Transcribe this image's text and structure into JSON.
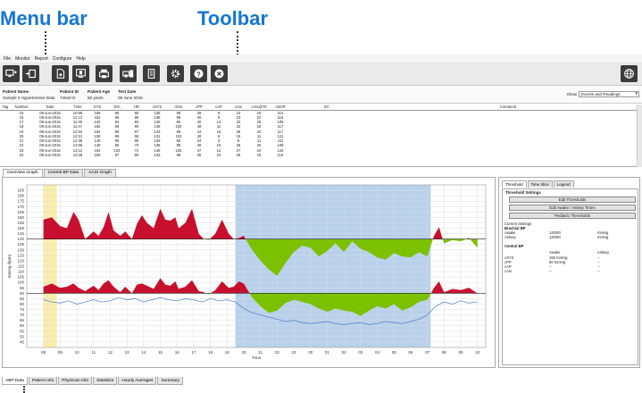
{
  "callouts": {
    "menu_bar": "Menu bar",
    "toolbar": "Toolbar"
  },
  "menu": [
    "File",
    "Monitor",
    "Report",
    "Configure",
    "Help"
  ],
  "toolbar_icons": [
    "monitor-arrow-icon",
    "device-arrow-icon",
    "document-plus-icon",
    "screen-document-icon",
    "printer-icon",
    "printer-stack-icon",
    "report-page-icon",
    "gear-icon",
    "help-icon",
    "close-icon"
  ],
  "globe_icon": "globe-icon",
  "patient": {
    "name_label": "Patient Name",
    "name": "Sample 2 Hypertensive Data",
    "id_label": "Patient ID",
    "id": "74642-D",
    "age_label": "Patient Age",
    "age": "65 years",
    "date_label": "Test Date",
    "date": "08 June 2015",
    "show_label": "Show",
    "show_value": "Events and Readings"
  },
  "table": {
    "headers": [
      "Tag",
      "Number",
      "Date",
      "Time",
      "SYS",
      "DIA",
      "HR",
      "cSYS",
      "cDIA",
      "cPP",
      "cAP",
      "cAIx",
      "cAIx@75",
      "cMAP",
      "EC",
      "Comment"
    ],
    "rows": [
      [
        "",
        "15",
        "09-Jun-2015",
        "10:56",
        "159",
        "99",
        "80",
        "138",
        "99",
        "39",
        "9",
        "23",
        "19",
        "114",
        "",
        ""
      ],
      [
        "",
        "16",
        "09-Jun-2015",
        "11:13",
        "152",
        "96",
        "88",
        "138",
        "98",
        "40",
        "9",
        "23",
        "22",
        "116",
        "",
        ""
      ],
      [
        "",
        "17",
        "09-Jun-2015",
        "11:30",
        "140",
        "84",
        "83",
        "129",
        "90",
        "40",
        "13",
        "32",
        "28",
        "105",
        "",
        ""
      ],
      [
        "",
        "18",
        "09-Jun-2015",
        "11:47",
        "162",
        "99",
        "80",
        "148",
        "100",
        "48",
        "11",
        "32",
        "15",
        "117",
        "",
        ""
      ],
      [
        "",
        "19",
        "09-Jun-2015",
        "12:04",
        "154",
        "98",
        "87",
        "143",
        "99",
        "44",
        "16",
        "36",
        "33",
        "117",
        "",
        ""
      ],
      [
        "",
        "20",
        "09-Jun-2015",
        "12:21",
        "108",
        "99",
        "66",
        "131",
        "102",
        "49",
        "8",
        "15",
        "11",
        "121",
        "",
        ""
      ],
      [
        "",
        "21",
        "09-Jun-2015",
        "12:38",
        "145",
        "95",
        "80",
        "129",
        "96",
        "34",
        "3",
        "8",
        "11",
        "111",
        "",
        ""
      ],
      [
        "",
        "22",
        "09-Jun-2015",
        "12:55",
        "148",
        "86",
        "70",
        "136",
        "88",
        "48",
        "19",
        "38",
        "35",
        "108",
        "",
        ""
      ],
      [
        "",
        "23",
        "09-Jun-2015",
        "13:12",
        "164",
        "102",
        "72",
        "149",
        "102",
        "47",
        "12",
        "27",
        "24",
        "122",
        "",
        ""
      ],
      [
        "",
        "24",
        "09-Jun-2015",
        "13:28",
        "150",
        "97",
        "80",
        "133",
        "98",
        "35",
        "10",
        "25",
        "18",
        "115",
        "",
        ""
      ]
    ]
  },
  "graph_tabs": [
    "Overview Graph",
    "Central BP Data",
    "AASI Graph"
  ],
  "right_tabs": [
    "Threshold",
    "Time Slice",
    "Legend"
  ],
  "threshold": {
    "title": "Threshold Settings",
    "buttons": [
      "Edit Thresholds",
      "Edit Awake / Asleep Times",
      "Pediatric Thresholds"
    ],
    "current": "Current Settings",
    "brachial": "Brachial BP",
    "awake_label": "Awake",
    "awake_val": "140/90",
    "awake_unit": "mmHg",
    "asleep_label": "Asleep",
    "asleep_val": "120/80",
    "asleep_unit": "mmHg",
    "central": "Central BP",
    "col_awake": "Awake",
    "col_asleep": "Asleep",
    "rows": [
      {
        "label": "cSYS",
        "awake": "150 mmHg",
        "asleep": "--"
      },
      {
        "label": "cPP",
        "awake": "50 mmHg",
        "asleep": "--"
      },
      {
        "label": "cAP",
        "awake": "--",
        "asleep": "--"
      },
      {
        "label": "cAIx",
        "awake": "--",
        "asleep": "--"
      }
    ]
  },
  "bottom_tabs": [
    "ABP Data",
    "Patient Info",
    "Physician Info",
    "Statistics",
    "Hourly Averages",
    "Summary"
  ],
  "chart_data": {
    "type": "area",
    "xlabel": "Time",
    "ylabel": "mmHg (bpm)",
    "ylim": [
      40,
      190
    ],
    "yticks": [
      45,
      50,
      55,
      60,
      65,
      70,
      75,
      80,
      85,
      90,
      95,
      100,
      105,
      110,
      115,
      120,
      125,
      130,
      135,
      140,
      145,
      150,
      155,
      160,
      165,
      170,
      175,
      180,
      185
    ],
    "x_tick_labels": [
      "08",
      "09",
      "10",
      "11",
      "12",
      "13",
      "14",
      "15",
      "16",
      "17",
      "18",
      "19",
      "20",
      "21",
      "22",
      "23",
      "00",
      "01",
      "02",
      "03",
      "04",
      "05",
      "06",
      "07",
      "08",
      "09",
      "10"
    ],
    "x_hours": [
      8,
      9,
      10,
      11,
      12,
      13,
      14,
      15,
      16,
      17,
      18,
      19,
      20,
      21,
      22,
      23,
      24,
      25,
      26,
      27,
      28,
      29,
      30,
      31,
      32,
      33,
      34
    ],
    "xlim": [
      7.0,
      34.5
    ],
    "highlight_band": {
      "x": [
        8.0,
        8.8
      ],
      "color": "#f9eeaa"
    },
    "sleep_band": {
      "x": [
        19.5,
        31.2
      ],
      "color": "#b8d0ec"
    },
    "grid": true,
    "legend": "none",
    "series": [
      {
        "key": "SYS",
        "threshold": 140,
        "above_color": "#c8102e",
        "below_color": "#7cc100",
        "x": [
          8.0,
          8.5,
          9.0,
          9.4,
          9.8,
          10.1,
          10.5,
          11.0,
          11.3,
          11.6,
          11.9,
          12.2,
          12.6,
          12.9,
          13.3,
          13.6,
          13.9,
          14.2,
          14.6,
          15.0,
          15.3,
          15.6,
          15.9,
          16.1,
          16.5,
          16.9,
          17.3,
          17.6,
          17.9,
          18.3,
          18.7,
          19.1,
          19.4,
          19.7,
          20.0,
          20.5,
          21.0,
          21.5,
          22.0,
          22.5,
          23.0,
          23.5,
          24.0,
          24.5,
          25.0,
          25.5,
          26.0,
          26.5,
          27.0,
          27.5,
          28.0,
          28.5,
          29.0,
          29.5,
          30.0,
          30.5,
          31.0,
          31.4,
          31.7,
          32.0,
          32.5,
          33.0,
          33.5,
          34.0
        ],
        "y": [
          158,
          160,
          152,
          150,
          165,
          158,
          140,
          147,
          143,
          151,
          165,
          148,
          143,
          147,
          140,
          154,
          162,
          155,
          150,
          168,
          158,
          157,
          160,
          150,
          155,
          168,
          145,
          140,
          139,
          145,
          158,
          145,
          140,
          141,
          143,
          130,
          120,
          112,
          106,
          118,
          128,
          134,
          132,
          124,
          129,
          136,
          128,
          138,
          131,
          128,
          123,
          121,
          127,
          124,
          123,
          128,
          124,
          143,
          151,
          136,
          139,
          138,
          141,
          132
        ]
      },
      {
        "key": "DIA",
        "threshold": 90,
        "above_color": "#c8102e",
        "below_color": "#7cc100",
        "x": [
          8.0,
          8.5,
          9.0,
          9.4,
          9.8,
          10.1,
          10.5,
          11.0,
          11.3,
          11.6,
          11.9,
          12.2,
          12.6,
          12.9,
          13.3,
          13.6,
          13.9,
          14.2,
          14.6,
          15.0,
          15.3,
          15.6,
          15.9,
          16.1,
          16.5,
          16.9,
          17.3,
          17.6,
          17.9,
          18.3,
          18.7,
          19.1,
          19.4,
          19.7,
          20.0,
          20.5,
          21.0,
          21.5,
          22.0,
          22.5,
          23.0,
          23.5,
          24.0,
          24.5,
          25.0,
          25.5,
          26.0,
          26.5,
          27.0,
          27.5,
          28.0,
          28.5,
          29.0,
          29.5,
          30.0,
          30.5,
          31.0,
          31.4,
          31.7,
          32.0,
          32.5,
          33.0,
          33.5,
          34.0
        ],
        "y": [
          96,
          99,
          95,
          96,
          99,
          95,
          92,
          97,
          93,
          99,
          102,
          96,
          91,
          96,
          90,
          98,
          99,
          97,
          94,
          104,
          98,
          97,
          101,
          94,
          96,
          102,
          92,
          91,
          89,
          93,
          101,
          95,
          96,
          101,
          99,
          86,
          78,
          72,
          74,
          81,
          84,
          82,
          80,
          76,
          73,
          76,
          74,
          73,
          69,
          74,
          78,
          76,
          80,
          74,
          77,
          82,
          84,
          95,
          101,
          91,
          94,
          93,
          95,
          90
        ]
      },
      {
        "key": "HR",
        "color": "#4a7cc8",
        "x": [
          8.0,
          8.5,
          9.0,
          9.5,
          10.0,
          10.5,
          11.0,
          11.5,
          12.0,
          12.5,
          13.0,
          13.5,
          14.0,
          14.5,
          15.0,
          15.5,
          16.0,
          16.5,
          17.0,
          17.5,
          18.0,
          18.5,
          19.0,
          19.5,
          20.0,
          20.5,
          21.0,
          21.5,
          22.0,
          22.5,
          23.0,
          23.5,
          24.0,
          24.5,
          25.0,
          25.5,
          26.0,
          26.5,
          27.0,
          27.5,
          28.0,
          28.5,
          29.0,
          29.5,
          30.0,
          30.5,
          31.0,
          31.5,
          32.0,
          32.5,
          33.0,
          33.5,
          34.0
        ],
        "y": [
          84,
          82,
          81,
          83,
          80,
          82,
          84,
          82,
          83,
          86,
          84,
          85,
          82,
          84,
          86,
          84,
          83,
          85,
          84,
          82,
          85,
          83,
          84,
          82,
          76,
          72,
          70,
          68,
          66,
          64,
          65,
          63,
          62,
          63,
          64,
          62,
          61,
          62,
          63,
          61,
          62,
          64,
          63,
          62,
          64,
          66,
          70,
          78,
          82,
          80,
          83,
          81,
          82
        ]
      }
    ]
  }
}
